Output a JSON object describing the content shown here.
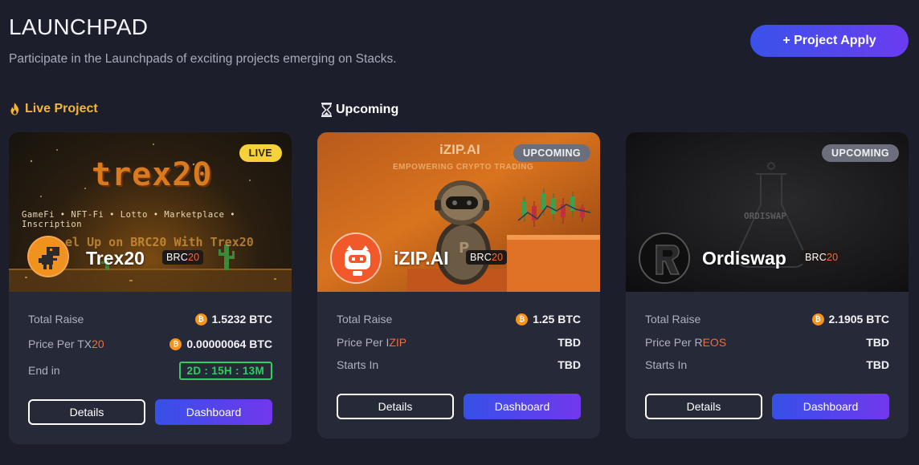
{
  "header": {
    "title": "LAUNCHPAD",
    "subtitle": "Participate in the Launchpads of exciting projects emerging on Stacks.",
    "apply_label": "+ Project Apply"
  },
  "sections": {
    "live_label": "Live Project",
    "upcoming_label": "Upcoming"
  },
  "colors": {
    "background": "#1c1e2b",
    "card": "#262938",
    "accent_gradient_start": "#3a52ea",
    "accent_gradient_end": "#6a3cf0",
    "live_badge": "#f6d23a",
    "countdown_green": "#2ecf5e",
    "btc_orange": "#f7931a"
  },
  "projects": [
    {
      "status": "LIVE",
      "name": "Trex20",
      "chain_prefix": "BRC",
      "chain_suffix": "20",
      "banner_logo": "trex20",
      "banner_tagline": "GameFi • NFT-Fi • Lotto • Marketplace • Inscription",
      "banner_marquee": "el Up on BRC20 With Trex20",
      "rows": [
        {
          "label": "Total Raise",
          "value": "1.5232 BTC"
        },
        {
          "label_prefix": "Price Per ",
          "label_ticker_a": "TX",
          "label_ticker_b": "20",
          "value": "0.00000064 BTC"
        },
        {
          "label": "End in",
          "value": "2D : 15H : 13M"
        }
      ],
      "details_label": "Details",
      "dashboard_label": "Dashboard"
    },
    {
      "status": "UPCOMING",
      "name": "iZIP.AI",
      "chain_prefix": "BRC",
      "chain_suffix": "20",
      "banner_title": "iZIP.AI",
      "banner_subtitle": "EMPOWERING CRYPTO TRADING",
      "rows": [
        {
          "label": "Total Raise",
          "value": "1.25 BTC"
        },
        {
          "label_prefix": "Price Per ",
          "label_ticker_a": "I",
          "label_ticker_b": "ZIP",
          "value": "TBD"
        },
        {
          "label": "Starts In",
          "value": "TBD"
        }
      ],
      "details_label": "Details",
      "dashboard_label": "Dashboard"
    },
    {
      "status": "UPCOMING",
      "name": "Ordiswap",
      "chain_prefix": "BRC",
      "chain_suffix": "20",
      "banner_title": "ORDISWAP",
      "rows": [
        {
          "label": "Total Raise",
          "value": "2.1905 BTC"
        },
        {
          "label_prefix": "Price Per ",
          "label_ticker_a": "R",
          "label_ticker_b": "EOS",
          "value": "TBD"
        },
        {
          "label": "Starts In",
          "value": "TBD"
        }
      ],
      "details_label": "Details",
      "dashboard_label": "Dashboard"
    }
  ],
  "icons": {
    "live_section": "flame-icon",
    "upcoming_section": "hourglass-icon",
    "currency": "bitcoin-icon"
  }
}
